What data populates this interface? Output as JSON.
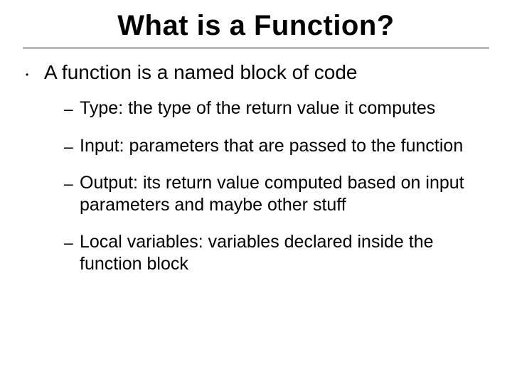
{
  "slide": {
    "title": "What is a Function?",
    "bullets_level1": [
      {
        "text": "A function is a named block of code"
      }
    ],
    "bullets_level2": [
      {
        "text": "Type: the type of the return value it computes"
      },
      {
        "text": "Input:  parameters that are passed to the function"
      },
      {
        "text": "Output:  its return value computed based on input parameters and maybe other stuff"
      },
      {
        "text": "Local variables: variables declared inside the function block"
      }
    ],
    "glyphs": {
      "level1_bullet": "•",
      "level2_bullet": "–"
    }
  }
}
